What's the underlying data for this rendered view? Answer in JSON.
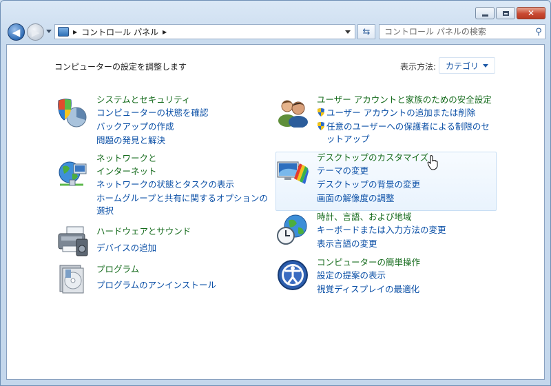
{
  "window": {
    "caption_buttons": {
      "minimize": "minimize",
      "maximize": "maximize",
      "close": "close"
    }
  },
  "address_bar": {
    "segments": [
      "コントロール パネル"
    ]
  },
  "search": {
    "placeholder": "コントロール パネルの検索"
  },
  "header": {
    "heading": "コンピューターの設定を調整します",
    "view_by_label": "表示方法:",
    "view_by_value": "カテゴリ"
  },
  "categories": {
    "system": {
      "title": "システムとセキュリティ",
      "links": [
        "コンピューターの状態を確認",
        "バックアップの作成",
        "問題の発見と解決"
      ]
    },
    "network": {
      "title_line1": "ネットワークと",
      "title_line2": "インターネット",
      "links": [
        "ネットワークの状態とタスクの表示",
        "ホームグループと共有に関するオプションの",
        "選択"
      ]
    },
    "hardware": {
      "title": "ハードウェアとサウンド",
      "links": [
        "デバイスの追加"
      ]
    },
    "programs": {
      "title": "プログラム",
      "links": [
        "プログラムのアンインストール"
      ]
    },
    "users": {
      "title": "ユーザー アカウントと家族のための安全設定",
      "links": [
        "ユーザー アカウントの追加または削除",
        "任意のユーザーへの保護者による制限のセ",
        "ットアップ"
      ]
    },
    "appearance": {
      "title": "デスクトップのカスタマイズ",
      "links": [
        "テーマの変更",
        "デスクトップの背景の変更",
        "画面の解像度の調整"
      ]
    },
    "clock": {
      "title": "時計、言語、および地域",
      "links": [
        "キーボードまたは入力方法の変更",
        "表示言語の変更"
      ]
    },
    "ease": {
      "title": "コンピューターの簡単操作",
      "links": [
        "設定の提案の表示",
        "視覚ディスプレイの最適化"
      ]
    }
  },
  "colors": {
    "category_title": "#156b1c",
    "link": "#0a4fa6",
    "hover_bg": "#e9f3fd"
  }
}
